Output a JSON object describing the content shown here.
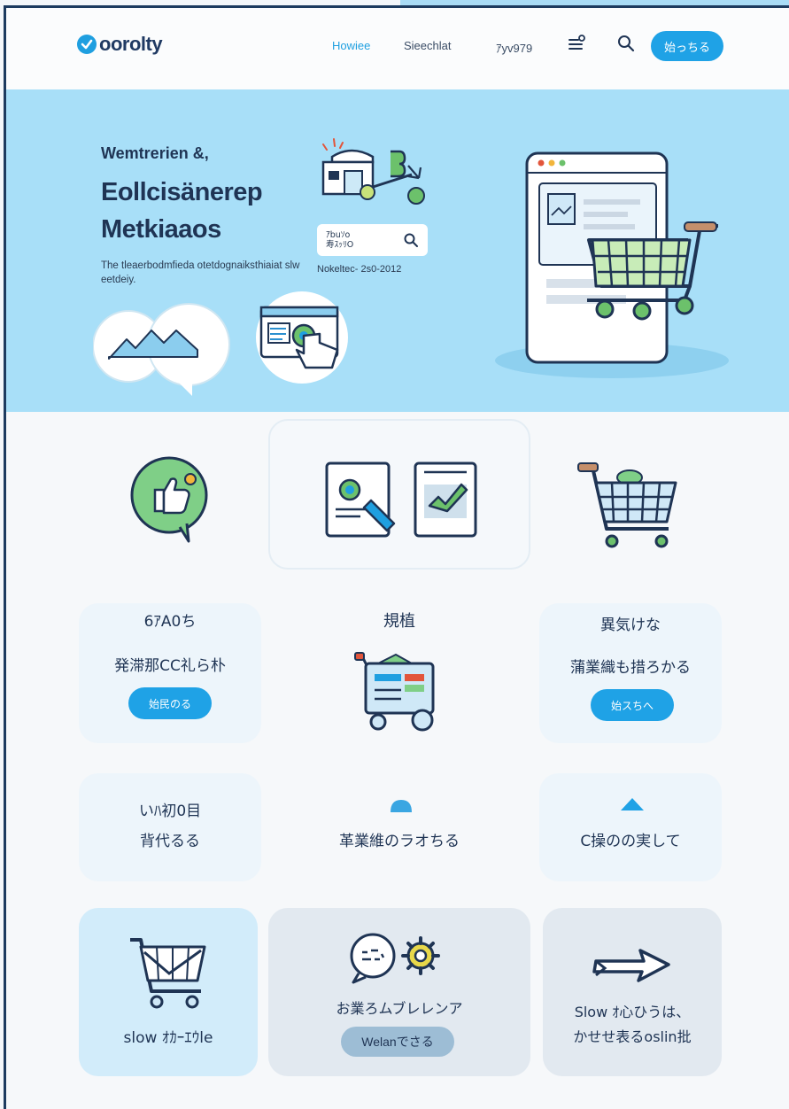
{
  "header": {
    "logo": "oorolty",
    "nav": [
      "Howiee",
      "Sieechlat",
      "ｱyv979"
    ],
    "cta_label": "始っちる"
  },
  "hero": {
    "kicker": "Wemtrerien &,",
    "title_line1": "Eollcisänerep",
    "title_line2": "Metkiaaos",
    "description": "The tleaerbodmfieda otetdognaiksthiaiat slw eetdeiy.",
    "search_line1": "ｱbuｿo",
    "search_line2": "寿ｽｯﾘO",
    "note": "Nokeltec-   2s0-2012"
  },
  "features": {
    "card1": {
      "title": "6ｱA0ち",
      "text": "発滞那CC礼ら朴",
      "button": "始民のる"
    },
    "card2": {
      "title": "規植"
    },
    "card3": {
      "title": "異気けな",
      "text": "蒲業織も措ろかる",
      "button": "始スちへ"
    },
    "card4": {
      "line1": "いﾊ初0目",
      "line2": "背代るる"
    },
    "card5": {
      "text": "革業維のラオちる"
    },
    "card6": {
      "text": "C操のの実して"
    },
    "card7": {
      "text": "slow  ｵｶｰｴｳle"
    },
    "card8": {
      "text": "お業ろムブレレンア",
      "button": "Welanでさる"
    },
    "card9": {
      "line1": "Slow  ｵ心ひうは、",
      "line2": "かせせ表るoslin批"
    }
  },
  "colors": {
    "accent": "#1fa2e6",
    "hero_bg": "#a8dff8",
    "navy": "#1f3454"
  }
}
